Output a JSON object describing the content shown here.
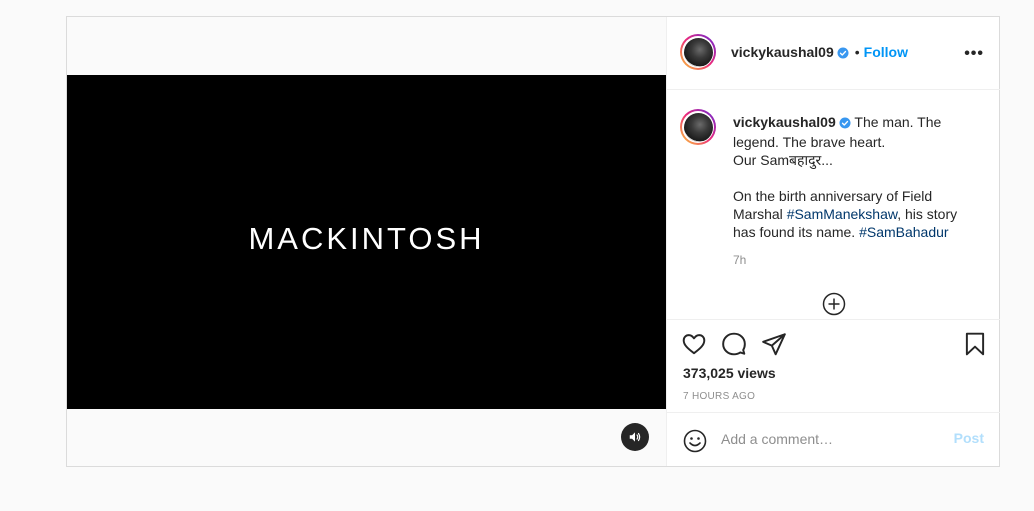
{
  "post": {
    "video": {
      "title_text": "MACKINTOSH",
      "mute_icon": "speaker-icon"
    },
    "header": {
      "username": "vickykaushal09",
      "separator": "•",
      "follow_label": "Follow",
      "more_icon": "more-options-icon",
      "more_glyph": "•••"
    },
    "caption": {
      "username": "vickykaushal09",
      "line_1": "The man. The legend. The brave heart.",
      "line_2": "Our Samबहादुर...",
      "para_2_start": "On the birth anniversary of Field Marshal ",
      "hashtag_1": "#SamManekshaw",
      "para_2_mid": ", his story has found its name. ",
      "hashtag_2": "#SamBahadur",
      "time_ago": "7h"
    },
    "actions": {
      "views": "373,025 views",
      "timestamp": "7 HOURS AGO"
    },
    "comment": {
      "placeholder": "Add a comment…",
      "post_label": "Post"
    }
  },
  "colors": {
    "accent": "#0095f6",
    "hashtag": "#00376b",
    "muted": "#8e8e8e",
    "post_disabled": "#b2dffc"
  }
}
